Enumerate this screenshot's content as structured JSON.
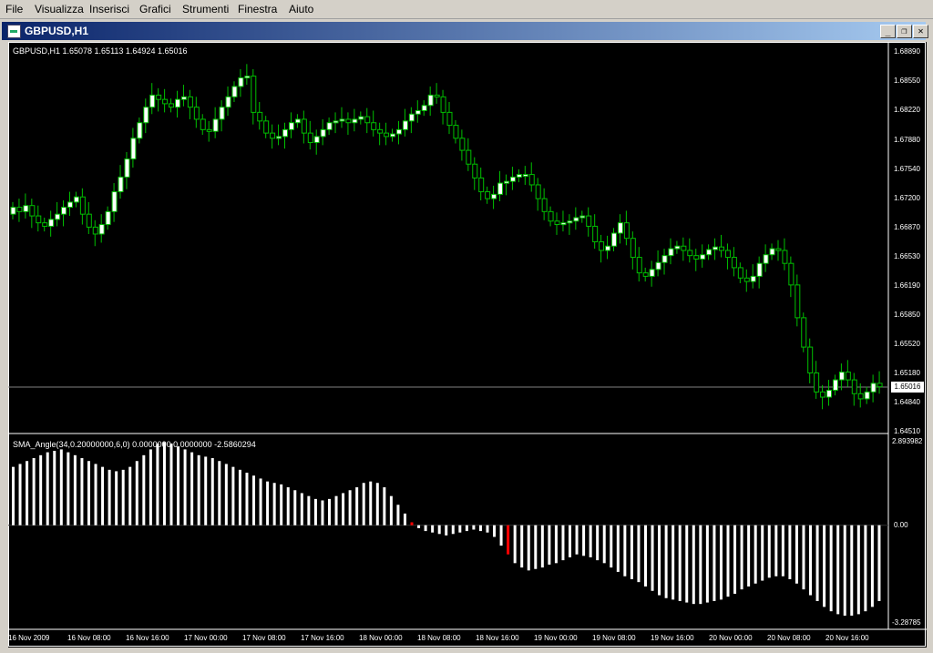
{
  "menu": [
    "File",
    "Visualizza",
    "Inserisci",
    "Grafici",
    "Strumenti",
    "Finestra",
    "Aiuto"
  ],
  "window": {
    "title": "GBPUSD,H1",
    "buttons": {
      "minimize": "_",
      "restore": "❐",
      "close": "✕"
    }
  },
  "chart_header": "GBPUSD,H1  1.65078 1.65113 1.64924 1.65016",
  "indicator_header": "SMA_Angle(34,0.20000000,6,0) 0.0000000 0.0000000 -2.5860294",
  "price_axis": [
    "1.68890",
    "1.68550",
    "1.68220",
    "1.67880",
    "1.67540",
    "1.67200",
    "1.66870",
    "1.66530",
    "1.66190",
    "1.65850",
    "1.65520",
    "1.65180",
    "1.64840",
    "1.64510"
  ],
  "current_price": "1.65016",
  "indicator_axis": [
    "2.893982",
    "0.00",
    "-3.28785"
  ],
  "time_axis": [
    "16 Nov 2009",
    "16 Nov 08:00",
    "16 Nov 16:00",
    "17 Nov 00:00",
    "17 Nov 08:00",
    "17 Nov 16:00",
    "18 Nov 00:00",
    "18 Nov 08:00",
    "18 Nov 16:00",
    "19 Nov 00:00",
    "19 Nov 08:00",
    "19 Nov 16:00",
    "20 Nov 00:00",
    "20 Nov 08:00",
    "20 Nov 16:00"
  ],
  "colors": {
    "background": "#000000",
    "bull_candle": "#ffffff",
    "wick": "#00c000",
    "indicator_bar": "#ffffff",
    "indicator_highlight": "#ff0000",
    "current_price_line": "#808080"
  },
  "chart_data": {
    "type": "candlestick",
    "price_ylim": [
      1.6451,
      1.6889
    ],
    "candle_close": [
      1.671,
      1.6705,
      1.6712,
      1.67,
      1.6692,
      1.6688,
      1.6696,
      1.6702,
      1.671,
      1.6716,
      1.6722,
      1.6702,
      1.6687,
      1.6679,
      1.669,
      1.6705,
      1.6728,
      1.6745,
      1.6766,
      1.679,
      1.6808,
      1.6826,
      1.684,
      1.6835,
      1.683,
      1.6826,
      1.6835,
      1.6838,
      1.6826,
      1.6812,
      1.68,
      1.6798,
      1.6812,
      1.6826,
      1.6838,
      1.685,
      1.686,
      1.6862,
      1.682,
      1.681,
      1.6796,
      1.679,
      1.6792,
      1.68,
      1.6808,
      1.6812,
      1.6796,
      1.6785,
      1.6792,
      1.68,
      1.6808,
      1.681,
      1.6812,
      1.6808,
      1.6812,
      1.6815,
      1.6808,
      1.68,
      1.6796,
      1.6792,
      1.6795,
      1.68,
      1.681,
      1.6818,
      1.6822,
      1.6828,
      1.684,
      1.6838,
      1.682,
      1.6805,
      1.679,
      1.6776,
      1.676,
      1.6744,
      1.6728,
      1.672,
      1.6725,
      1.6738,
      1.674,
      1.6745,
      1.6748,
      1.6748,
      1.6736,
      1.672,
      1.6705,
      1.6694,
      1.669,
      1.6692,
      1.6694,
      1.6698,
      1.67,
      1.6688,
      1.667,
      1.666,
      1.6665,
      1.668,
      1.6692,
      1.6674,
      1.6652,
      1.6634,
      1.663,
      1.6638,
      1.6646,
      1.6654,
      1.6662,
      1.6665,
      1.666,
      1.6654,
      1.665,
      1.6655,
      1.6661,
      1.6664,
      1.666,
      1.6652,
      1.664,
      1.6628,
      1.6624,
      1.663,
      1.6645,
      1.6655,
      1.6662,
      1.666,
      1.6645,
      1.662,
      1.6582,
      1.6548,
      1.6518,
      1.6496,
      1.649,
      1.6498,
      1.651,
      1.6519,
      1.651,
      1.6494,
      1.6488,
      1.6496,
      1.6506,
      1.6502
    ],
    "indicator_ylim": [
      -3.28785,
      2.893982
    ],
    "indicator_values": [
      2.0,
      2.1,
      2.2,
      2.3,
      2.4,
      2.5,
      2.55,
      2.6,
      2.5,
      2.4,
      2.3,
      2.2,
      2.1,
      2.0,
      1.9,
      1.85,
      1.9,
      2.0,
      2.2,
      2.4,
      2.6,
      2.8,
      2.85,
      2.8,
      2.7,
      2.6,
      2.5,
      2.4,
      2.35,
      2.3,
      2.2,
      2.1,
      2.0,
      1.9,
      1.8,
      1.7,
      1.6,
      1.5,
      1.45,
      1.4,
      1.3,
      1.2,
      1.1,
      1.0,
      0.9,
      0.85,
      0.9,
      1.0,
      1.1,
      1.2,
      1.3,
      1.45,
      1.5,
      1.45,
      1.3,
      1.0,
      0.7,
      0.4,
      0.1,
      -0.1,
      -0.2,
      -0.25,
      -0.3,
      -0.35,
      -0.3,
      -0.25,
      -0.2,
      -0.15,
      -0.2,
      -0.25,
      -0.4,
      -0.7,
      -1.0,
      -1.3,
      -1.45,
      -1.55,
      -1.5,
      -1.45,
      -1.35,
      -1.3,
      -1.2,
      -1.1,
      -1.0,
      -1.05,
      -1.1,
      -1.2,
      -1.3,
      -1.45,
      -1.6,
      -1.75,
      -1.85,
      -1.95,
      -2.1,
      -2.25,
      -2.4,
      -2.5,
      -2.55,
      -2.6,
      -2.65,
      -2.7,
      -2.7,
      -2.65,
      -2.6,
      -2.55,
      -2.45,
      -2.35,
      -2.2,
      -2.1,
      -2.0,
      -1.9,
      -1.8,
      -1.75,
      -1.75,
      -1.85,
      -2.0,
      -2.2,
      -2.4,
      -2.6,
      -2.8,
      -2.95,
      -3.05,
      -3.1,
      -3.1,
      -3.05,
      -2.95,
      -2.8,
      -2.6
    ],
    "indicator_red_indices": [
      58,
      72
    ]
  }
}
